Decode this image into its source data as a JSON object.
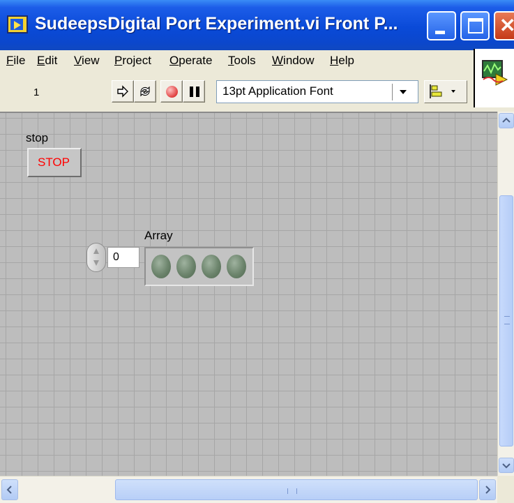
{
  "window": {
    "title": "SudeepsDigital Port Experiment.vi Front P...",
    "icon": "labview-vi-icon"
  },
  "menu": {
    "items": [
      {
        "label": "File",
        "mnemonic": "F"
      },
      {
        "label": "Edit",
        "mnemonic": "E"
      },
      {
        "label": "View",
        "mnemonic": "V"
      },
      {
        "label": "Project",
        "mnemonic": "P"
      },
      {
        "label": "Operate",
        "mnemonic": "O"
      },
      {
        "label": "Tools",
        "mnemonic": "T"
      },
      {
        "label": "Window",
        "mnemonic": "W"
      },
      {
        "label": "Help",
        "mnemonic": "H"
      }
    ]
  },
  "toolbar": {
    "font_selected": "13pt Application Font",
    "buttons": [
      "run-arrow-icon",
      "run-continuously-icon",
      "abort-icon",
      "pause-icon",
      "align-objects-icon"
    ]
  },
  "connector_pane": {
    "number": "1"
  },
  "front_panel": {
    "stop_control": {
      "label": "stop",
      "button_text": "STOP",
      "text_color": "#ff0000"
    },
    "array_indicator": {
      "label": "Array",
      "index_value": "0",
      "led_count": 4,
      "led_color": "#6c846c"
    },
    "grid_color": "#a6a6a6",
    "background_color": "#bdbdbd"
  },
  "colors": {
    "titlebar_blue": "#0a4ad8",
    "close_red": "#c53a18",
    "chrome": "#ece9d8"
  }
}
